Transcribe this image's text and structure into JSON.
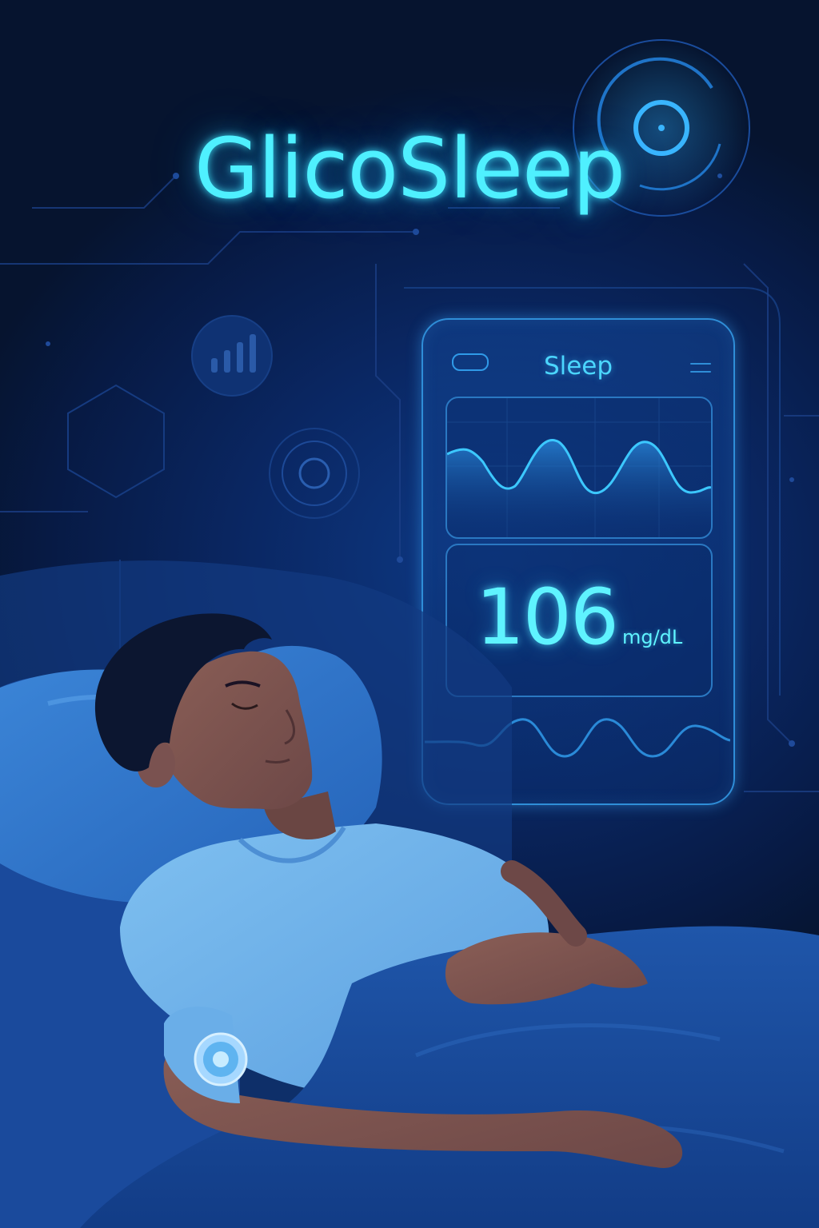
{
  "app": {
    "title": "GlicoSleep"
  },
  "phone": {
    "header": "Sleep",
    "reading": {
      "value": "106",
      "unit": "mg/dL"
    }
  },
  "colors": {
    "accent": "#4ff0ff",
    "background": "#0a2763",
    "panel_border": "#2f8ed8",
    "shirt": "#6aaee8",
    "blanket": "#1a4fa0"
  },
  "icons": [
    "signal-ring-icon",
    "bar-chart-icon",
    "hexagon-icon",
    "target-ring-icon",
    "menu-icon",
    "cgm-sensor-icon"
  ]
}
